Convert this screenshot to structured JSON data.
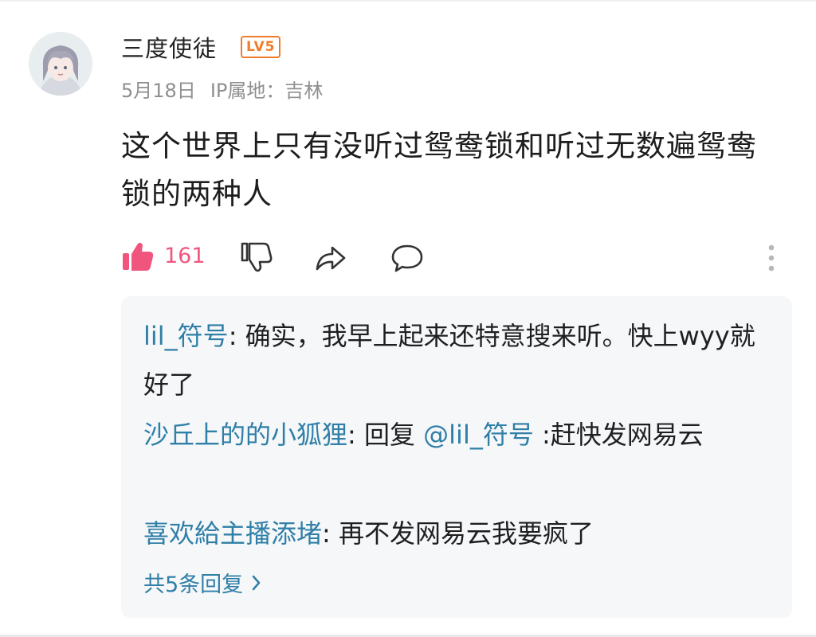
{
  "comment": {
    "username": "三度使徒",
    "level_badge": "LV5",
    "date": "5月18日",
    "ip_location": "IP属地：吉林",
    "text": "这个世界上只有没听过鸳鸯锁和听过无数遍鸳鸯锁的两种人",
    "like_count": "161"
  },
  "icons": {
    "like": "thumbs-up-icon",
    "dislike": "thumbs-down-icon",
    "share": "share-icon",
    "reply": "comment-icon",
    "more": "more-vertical-icon",
    "total": "chevron-right-icon"
  },
  "colors": {
    "like": "#f0567d",
    "reply_name": "#2f7fa7",
    "level_badge": "#f07c2a",
    "reply_background": "#f6f7f9"
  },
  "replies": [
    {
      "author": "lil_符号",
      "text": "确实，我早上起来还特意搜来听。快上wyy就好了"
    },
    {
      "author": "沙丘上的的小狐狸",
      "prefix": "回复",
      "mention": "@lil_符号",
      "text": "赶快发网易云"
    },
    {
      "author": "喜欢給主播添堵",
      "text": "再不发网易云我要疯了"
    }
  ],
  "total_replies_label": "共5条回复"
}
